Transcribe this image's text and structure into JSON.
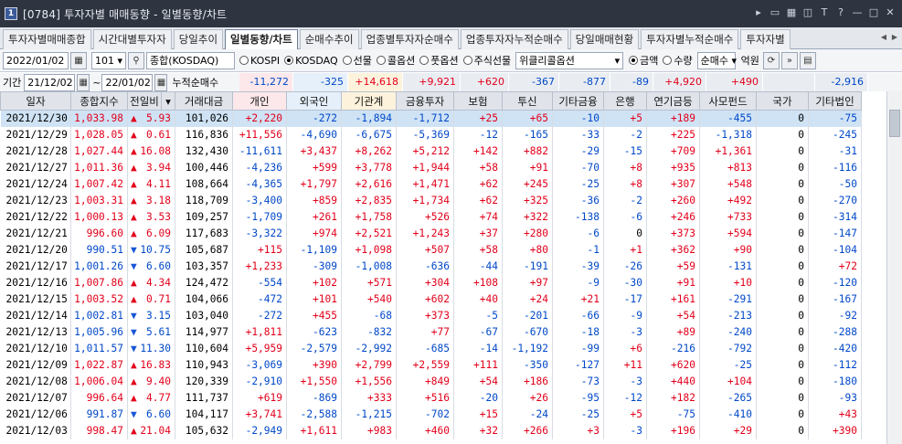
{
  "window": {
    "code": "[0784]",
    "title": "투자자별 매매동향 - 일별동향/차트"
  },
  "tabs": [
    "투자자별매매종합",
    "시간대별투자자",
    "당일추이",
    "일별동향/차트",
    "순매수추이",
    "업종별투자자순매수",
    "업종투자자누적순매수",
    "당일매매현황",
    "투자자별누적순매수",
    "투자자별"
  ],
  "active_tab": "일별동향/차트",
  "toolbar": {
    "date": "2022/01/02",
    "market_code": "101",
    "market_name": "종합(KOSDAQ)",
    "radios": [
      {
        "label": "KOSPI",
        "on": false
      },
      {
        "label": "KOSDAQ",
        "on": true
      },
      {
        "label": "선물",
        "on": false
      },
      {
        "label": "콜옵션",
        "on": false
      },
      {
        "label": "풋옵션",
        "on": false
      },
      {
        "label": "주식선물",
        "on": false
      }
    ],
    "weekly_option": "위클리콜옵션",
    "unit_radios": [
      {
        "label": "금액",
        "on": true
      },
      {
        "label": "수량",
        "on": false
      }
    ],
    "mode": "순매수",
    "unit": "억원"
  },
  "period": {
    "label": "기간",
    "from": "21/12/02",
    "sep": "~",
    "to": "22/01/02",
    "cum_label": "누적순매수"
  },
  "cumulative": [
    "-11,272",
    "-325",
    "+14,618",
    "+9,921",
    "+620",
    "-367",
    "-877",
    "-89",
    "+4,920",
    "+490",
    "",
    "-2,916"
  ],
  "columns": [
    "일자",
    "종합지수",
    "전일비",
    "",
    "거래대금",
    "개인",
    "외국인",
    "기관계",
    "금융투자",
    "보험",
    "투신",
    "기타금융",
    "은행",
    "연기금등",
    "사모펀드",
    "국가",
    "기타법인"
  ],
  "rows": [
    {
      "date": "2021/12/30",
      "index": "1,033.98",
      "dir": "up",
      "chg": "5.93",
      "vol": "101,026",
      "v": [
        "+2,220",
        "-272",
        "-1,894",
        "-1,712",
        "+25",
        "+65",
        "-10",
        "+5",
        "+189",
        "-455",
        "0",
        "-75"
      ]
    },
    {
      "date": "2021/12/29",
      "index": "1,028.05",
      "dir": "up",
      "chg": "0.61",
      "vol": "116,836",
      "v": [
        "+11,556",
        "-4,690",
        "-6,675",
        "-5,369",
        "-12",
        "-165",
        "-33",
        "-2",
        "+225",
        "-1,318",
        "0",
        "-245"
      ]
    },
    {
      "date": "2021/12/28",
      "index": "1,027.44",
      "dir": "up",
      "chg": "16.08",
      "vol": "132,430",
      "v": [
        "-11,611",
        "+3,437",
        "+8,262",
        "+5,212",
        "+142",
        "+882",
        "-29",
        "-15",
        "+709",
        "+1,361",
        "0",
        "-31"
      ]
    },
    {
      "date": "2021/12/27",
      "index": "1,011.36",
      "dir": "up",
      "chg": "3.94",
      "vol": "100,446",
      "v": [
        "-4,236",
        "+599",
        "+3,778",
        "+1,944",
        "+58",
        "+91",
        "-70",
        "+8",
        "+935",
        "+813",
        "0",
        "-116"
      ]
    },
    {
      "date": "2021/12/24",
      "index": "1,007.42",
      "dir": "up",
      "chg": "4.11",
      "vol": "108,664",
      "v": [
        "-4,365",
        "+1,797",
        "+2,616",
        "+1,471",
        "+62",
        "+245",
        "-25",
        "+8",
        "+307",
        "+548",
        "0",
        "-50"
      ]
    },
    {
      "date": "2021/12/23",
      "index": "1,003.31",
      "dir": "up",
      "chg": "3.18",
      "vol": "118,709",
      "v": [
        "-3,400",
        "+859",
        "+2,835",
        "+1,734",
        "+62",
        "+325",
        "-36",
        "-2",
        "+260",
        "+492",
        "0",
        "-270"
      ]
    },
    {
      "date": "2021/12/22",
      "index": "1,000.13",
      "dir": "up",
      "chg": "3.53",
      "vol": "109,257",
      "v": [
        "-1,709",
        "+261",
        "+1,758",
        "+526",
        "+74",
        "+322",
        "-138",
        "-6",
        "+246",
        "+733",
        "0",
        "-314"
      ]
    },
    {
      "date": "2021/12/21",
      "index": "996.60",
      "dir": "up",
      "chg": "6.09",
      "vol": "117,683",
      "v": [
        "-3,322",
        "+974",
        "+2,521",
        "+1,243",
        "+37",
        "+280",
        "-6",
        "0",
        "+373",
        "+594",
        "0",
        "-147"
      ]
    },
    {
      "date": "2021/12/20",
      "index": "990.51",
      "dir": "down",
      "chg": "10.75",
      "vol": "105,687",
      "v": [
        "+115",
        "-1,109",
        "+1,098",
        "+507",
        "+58",
        "+80",
        "-1",
        "+1",
        "+362",
        "+90",
        "0",
        "-104"
      ]
    },
    {
      "date": "2021/12/17",
      "index": "1,001.26",
      "dir": "down",
      "chg": "6.60",
      "vol": "103,357",
      "v": [
        "+1,233",
        "-309",
        "-1,008",
        "-636",
        "-44",
        "-191",
        "-39",
        "-26",
        "+59",
        "-131",
        "0",
        "+72"
      ]
    },
    {
      "date": "2021/12/16",
      "index": "1,007.86",
      "dir": "up",
      "chg": "4.34",
      "vol": "124,472",
      "v": [
        "-554",
        "+102",
        "+571",
        "+304",
        "+108",
        "+97",
        "-9",
        "-30",
        "+91",
        "+10",
        "0",
        "-120"
      ]
    },
    {
      "date": "2021/12/15",
      "index": "1,003.52",
      "dir": "up",
      "chg": "0.71",
      "vol": "104,066",
      "v": [
        "-472",
        "+101",
        "+540",
        "+602",
        "+40",
        "+24",
        "+21",
        "-17",
        "+161",
        "-291",
        "0",
        "-167"
      ]
    },
    {
      "date": "2021/12/14",
      "index": "1,002.81",
      "dir": "down",
      "chg": "3.15",
      "vol": "103,040",
      "v": [
        "-272",
        "+455",
        "-68",
        "+373",
        "-5",
        "-201",
        "-66",
        "-9",
        "+54",
        "-213",
        "0",
        "-92"
      ]
    },
    {
      "date": "2021/12/13",
      "index": "1,005.96",
      "dir": "down",
      "chg": "5.61",
      "vol": "114,977",
      "v": [
        "+1,811",
        "-623",
        "-832",
        "+77",
        "-67",
        "-670",
        "-18",
        "-3",
        "+89",
        "-240",
        "0",
        "-288"
      ]
    },
    {
      "date": "2021/12/10",
      "index": "1,011.57",
      "dir": "down",
      "chg": "11.30",
      "vol": "110,604",
      "v": [
        "+5,959",
        "-2,579",
        "-2,992",
        "-685",
        "-14",
        "-1,192",
        "-99",
        "+6",
        "-216",
        "-792",
        "0",
        "-420"
      ]
    },
    {
      "date": "2021/12/09",
      "index": "1,022.87",
      "dir": "up",
      "chg": "16.83",
      "vol": "110,943",
      "v": [
        "-3,069",
        "+390",
        "+2,799",
        "+2,559",
        "+111",
        "-350",
        "-127",
        "+11",
        "+620",
        "-25",
        "0",
        "-112"
      ]
    },
    {
      "date": "2021/12/08",
      "index": "1,006.04",
      "dir": "up",
      "chg": "9.40",
      "vol": "120,339",
      "v": [
        "-2,910",
        "+1,550",
        "+1,556",
        "+849",
        "+54",
        "+186",
        "-73",
        "-3",
        "+440",
        "+104",
        "0",
        "-180"
      ]
    },
    {
      "date": "2021/12/07",
      "index": "996.64",
      "dir": "up",
      "chg": "4.77",
      "vol": "111,737",
      "v": [
        "+619",
        "-869",
        "+333",
        "+516",
        "-20",
        "+26",
        "-95",
        "-12",
        "+182",
        "-265",
        "0",
        "-93"
      ]
    },
    {
      "date": "2021/12/06",
      "index": "991.87",
      "dir": "down",
      "chg": "6.60",
      "vol": "104,117",
      "v": [
        "+3,741",
        "-2,588",
        "-1,215",
        "-702",
        "+15",
        "-24",
        "-25",
        "+5",
        "-75",
        "-410",
        "0",
        "+43"
      ]
    },
    {
      "date": "2021/12/03",
      "index": "998.47",
      "dir": "up",
      "chg": "21.04",
      "vol": "105,632",
      "v": [
        "-2,949",
        "+1,611",
        "+983",
        "+460",
        "+32",
        "+266",
        "+3",
        "-3",
        "+196",
        "+29",
        "0",
        "+390"
      ]
    }
  ],
  "colors": {
    "up": "#e2001a",
    "down": "#0048c8",
    "header_bg": "#e0e4ea",
    "selected_row": "#cfe3f5",
    "individual_bg": "#fce8ea",
    "foreign_bg": "#e6f0fb",
    "institution_bg": "#fdf3dd"
  }
}
